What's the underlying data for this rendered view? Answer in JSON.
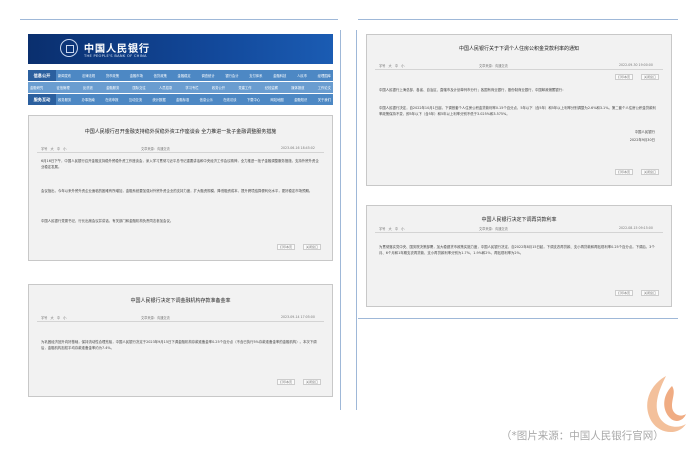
{
  "banner": {
    "bank_name_cn": "中国人民银行",
    "bank_name_en": "THE PEOPLE'S BANK OF CHINA"
  },
  "nav": {
    "row1_label": "信息公开",
    "row1_items": [
      "新闻发布",
      "法律法规",
      "货币政策",
      "金融市场",
      "信贷政策",
      "金融稳定",
      "调查统计",
      "银行会计",
      "支付体系",
      "金融科技",
      "人民币",
      "经理国库"
    ],
    "row2_label": "服务互动",
    "row2_items": [
      "金融研究",
      "征信管理",
      "反洗钱",
      "金融服务",
      "国际交往",
      "人员招录",
      "学习专栏",
      "政务公开",
      "党建工作",
      "纪检监察",
      "媒体报道",
      "工作论文"
    ],
    "row3_items": [
      "政务服务",
      "办事指南",
      "在线申报",
      "互动交流",
      "统计数据",
      "金融标准",
      "信息公示",
      "在线访谈",
      "下载中心",
      "网站地图",
      "金融知识",
      "关于我们"
    ]
  },
  "breadcrumb": "2023年6月16日　星期五　|　首页 > 新闻发布",
  "articles": [
    {
      "title": "中国人民银行召开金融支持稳外贸稳外资工作座谈会 全力推进一批子金融调整服务措施",
      "meta_left": "字号　大　中　小",
      "meta_mid": "文章来源：沟通交流",
      "meta_right": "2023-06-16 18:45:02",
      "paragraphs": [
        "6月16日下午，中国人民银行召开金融支持稳外贸稳外资工作座谈会，深入学习贯彻习近平总书记重要讲话和中央经济工作会议精神，全力推进一批子金融调整服务措施，支持外贸外资企业稳定发展。",
        "会议指出，今年以来外贸外资企业面临的困难有所增加，金融系统要加强对外贸外资企业的支持力度，扩大融资规模，降低融资成本，提升跨境结算便利化水平，更好稳定市场预期。",
        "中国人民银行党委书记、行长出席会议并讲话，有关部门和金融机构负责同志参加会议。"
      ],
      "tool_print": "打印本页",
      "tool_close": "关闭窗口"
    },
    {
      "title": "中国人民银行决定下调金融机构存款准备金率",
      "meta_left": "字号　大　中　小",
      "meta_mid": "文章来源：沟通交流",
      "meta_right": "2023-09-14 17:05:00",
      "paragraphs": [
        "为巩固经济回升向好基础，保持流动性合理充裕，中国人民银行决定于2023年9月15日下调金融机构存款准备金率0.25个百分点（不含已执行5%存款准备金率的金融机构）。本次下调后，金融机构加权平均存款准备金率约为7.4%。"
      ],
      "tool_print": "打印本页",
      "tool_close": "关闭窗口"
    },
    {
      "title": "中国人民银行关于下调个人住房公积金贷款利率的通知",
      "meta_left": "字号　大　中　小",
      "meta_mid": "文章来源：沟通交流",
      "meta_right": "2022-09-30 19:00:00",
      "paragraphs": [
        "中国人民银行上海总部，各省、自治区、直辖市及计划单列市分行；各国有商业银行，股份制商业银行，中国邮政储蓄银行：",
        "中国人民银行决定，自2022年10月1日起，下调首套个人住房公积金贷款利率0.15个百分点，5年以下（含5年）和5年以上利率分别调整为2.6%和3.1%。第二套个人住房公积金贷款利率政策保持不变，即5年以下（含5年）和5年以上利率分别不低于3.025%和3.575%。"
      ],
      "sign_org": "中国人民银行",
      "sign_date": "2022年9月30日",
      "tool_print": "打印本页",
      "tool_close": "关闭窗口"
    },
    {
      "title": "中国人民银行决定下调再贷款利率",
      "meta_left": "字号　大　中　小",
      "meta_mid": "文章来源：沟通交流",
      "meta_right": "2022-08-15 09:15:00",
      "paragraphs": [
        "为贯彻落实党中央、国务院决策部署，加大稳健货币政策实施力度，中国人民银行决定，自2022年8月15日起，下调支农再贷款、支小再贷款和再贴现利率0.25个百分点。下调后，3个月、6个月和1年期支农再贷款、支小再贷款利率分别为1.7%、1.9%和2%，再贴现利率为2%。"
      ],
      "tool_print": "打印本页",
      "tool_close": "关闭窗口"
    }
  ],
  "caption": "（*图片来源：中国人民银行官网）",
  "colors": {
    "banner": "#0a2f6e",
    "nav": "#4d88c4",
    "card": "#f2f2f2",
    "frame": "#9fb8d8"
  }
}
